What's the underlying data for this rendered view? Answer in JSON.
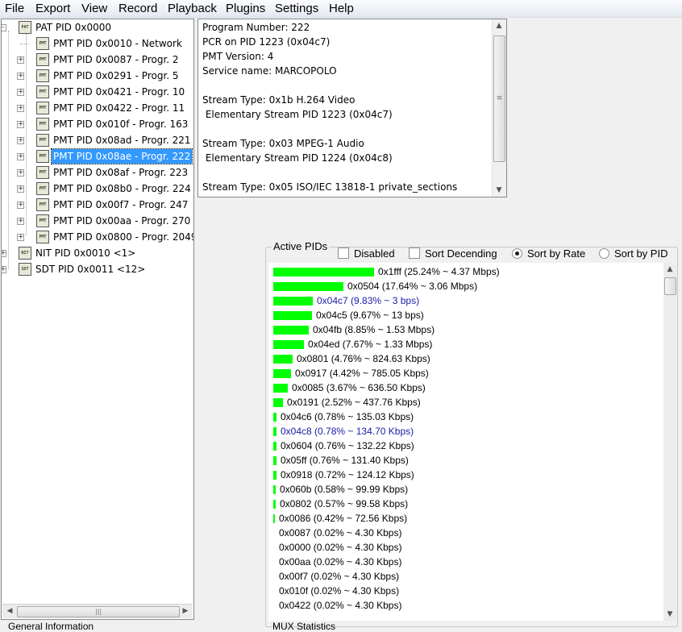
{
  "menu": [
    "File",
    "Export",
    "View",
    "Record",
    "Playback",
    "Plugins",
    "Settings",
    "Help"
  ],
  "tree": {
    "root": {
      "label": "PAT PID 0x0000",
      "icon": "PAT"
    },
    "children": [
      {
        "label": "PMT PID 0x0010 - Network",
        "icon": "PMT",
        "expandable": false
      },
      {
        "label": "PMT PID 0x0087 - Progr. 2",
        "icon": "PMT",
        "expandable": true
      },
      {
        "label": "PMT PID 0x0291 - Progr. 5",
        "icon": "PMT",
        "expandable": true
      },
      {
        "label": "PMT PID 0x0421 - Progr. 10",
        "icon": "PMT",
        "expandable": true
      },
      {
        "label": "PMT PID 0x0422 - Progr. 11",
        "icon": "PMT",
        "expandable": true
      },
      {
        "label": "PMT PID 0x010f - Progr. 163",
        "icon": "PMT",
        "expandable": true
      },
      {
        "label": "PMT PID 0x08ad - Progr. 221",
        "icon": "PMT",
        "expandable": true
      },
      {
        "label": "PMT PID 0x08ae - Progr. 222",
        "icon": "PMT",
        "expandable": true,
        "selected": true
      },
      {
        "label": "PMT PID 0x08af - Progr. 223",
        "icon": "PMT",
        "expandable": true
      },
      {
        "label": "PMT PID 0x08b0 - Progr. 224",
        "icon": "PMT",
        "expandable": true
      },
      {
        "label": "PMT PID 0x00f7 - Progr. 247",
        "icon": "PMT",
        "expandable": true
      },
      {
        "label": "PMT PID 0x00aa - Progr. 270",
        "icon": "PMT",
        "expandable": true
      },
      {
        "label": "PMT PID 0x0800 - Progr. 2049",
        "icon": "PMT",
        "expandable": true
      }
    ],
    "siblings": [
      {
        "label": "NIT PID 0x0010 <1>",
        "icon": "NIT"
      },
      {
        "label": "SDT PID 0x0011 <12>",
        "icon": "SDT"
      }
    ]
  },
  "info_lines": [
    "Program Number: 222",
    "PCR on PID 1223 (0x04c7)",
    "PMT Version: 4",
    "Service name: MARCOPOLO",
    "",
    "Stream Type: 0x1b H.264 Video",
    " Elementary Stream PID 1223 (0x04c7)",
    "",
    "Stream Type: 0x03 MPEG-1 Audio",
    " Elementary Stream PID 1224 (0x04c8)",
    "",
    "Stream Type: 0x05 ISO/IEC 13818-1 private_sections"
  ],
  "active_pids": {
    "title": "Active PIDs",
    "options": [
      {
        "label": "Disabled",
        "type": "checkbox",
        "checked": false
      },
      {
        "label": "Sort Decending",
        "type": "checkbox",
        "checked": false
      },
      {
        "label": "Sort by Rate",
        "type": "radio",
        "checked": true
      },
      {
        "label": "Sort by PID",
        "type": "radio",
        "checked": false
      }
    ],
    "rows": [
      {
        "label": "0x1fff (25.24% ~ 4.37 Mbps)",
        "percent": 25.24
      },
      {
        "label": "0x0504 (17.64% ~ 3.06 Mbps)",
        "percent": 17.64
      },
      {
        "label": "0x04c7 (9.83% ~ 3 bps)",
        "percent": 9.83,
        "highlight": true
      },
      {
        "label": "0x04c5 (9.67% ~ 13 bps)",
        "percent": 9.67
      },
      {
        "label": "0x04fb (8.85% ~ 1.53 Mbps)",
        "percent": 8.85
      },
      {
        "label": "0x04ed (7.67% ~ 1.33 Mbps)",
        "percent": 7.67
      },
      {
        "label": "0x0801 (4.76% ~ 824.63 Kbps)",
        "percent": 4.76
      },
      {
        "label": "0x0917 (4.42% ~ 785.05 Kbps)",
        "percent": 4.42
      },
      {
        "label": "0x0085 (3.67% ~ 636.50 Kbps)",
        "percent": 3.67
      },
      {
        "label": "0x0191 (2.52% ~ 437.76 Kbps)",
        "percent": 2.52
      },
      {
        "label": "0x04c6 (0.78% ~ 135.03 Kbps)",
        "percent": 0.78
      },
      {
        "label": "0x04c8 (0.78% ~ 134.70 Kbps)",
        "percent": 0.78,
        "highlight": true
      },
      {
        "label": "0x0604 (0.76% ~ 132.22 Kbps)",
        "percent": 0.76
      },
      {
        "label": "0x05ff (0.76% ~ 131.40 Kbps)",
        "percent": 0.76
      },
      {
        "label": "0x0918 (0.72% ~ 124.12 Kbps)",
        "percent": 0.72
      },
      {
        "label": "0x060b (0.58% ~ 99.99 Kbps)",
        "percent": 0.58
      },
      {
        "label": "0x0802 (0.57% ~ 99.58 Kbps)",
        "percent": 0.57
      },
      {
        "label": "0x0086 (0.42% ~ 72.56 Kbps)",
        "percent": 0.42
      },
      {
        "label": "0x0087 (0.02% ~ 4.30 Kbps)",
        "percent": 0.02
      },
      {
        "label": "0x0000 (0.02% ~ 4.30 Kbps)",
        "percent": 0.02
      },
      {
        "label": "0x00aa (0.02% ~ 4.30 Kbps)",
        "percent": 0.02
      },
      {
        "label": "0x00f7 (0.02% ~ 4.30 Kbps)",
        "percent": 0.02
      },
      {
        "label": "0x010f (0.02% ~ 4.30 Kbps)",
        "percent": 0.02
      },
      {
        "label": "0x0422 (0.02% ~ 4.30 Kbps)",
        "percent": 0.02
      }
    ]
  },
  "bottom": {
    "general": "General Information",
    "stats": "MUX Statistics"
  },
  "colors": {
    "bar": "#00ff00",
    "selection": "#3399ff",
    "highlight_text": "#1a1aa8"
  }
}
